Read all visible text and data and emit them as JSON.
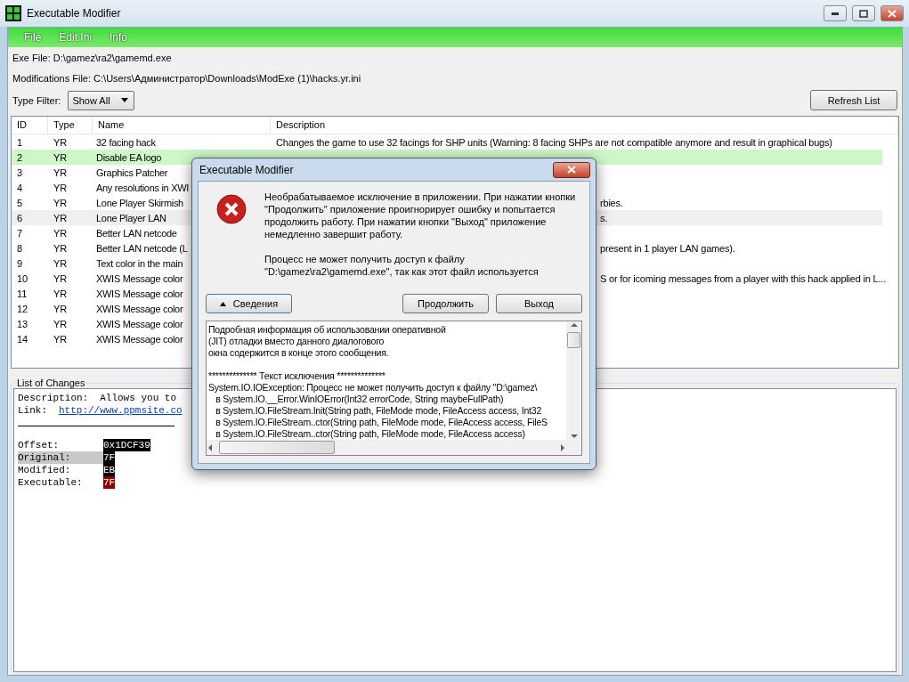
{
  "window": {
    "title": "Executable Modifier"
  },
  "menu": [
    "File",
    "Edit Ini",
    "Info"
  ],
  "exe_file": "Exe File: D:\\gamez\\ra2\\gamemd.exe",
  "modifications_file": "Modifications File: C:\\Users\\Администратор\\Downloads\\ModExe (1)\\hacks.yr.ini",
  "type_filter": {
    "label": "Type Filter:",
    "value": "Show All"
  },
  "refresh_button": "Refresh List",
  "table": {
    "columns": [
      "ID",
      "Type",
      "Name",
      "Description"
    ],
    "rows": [
      {
        "id": "1",
        "type": "YR",
        "name": "32 facing hack",
        "description": "Changes the game to use 32 facings for SHP units (Warning: 8 facing SHPs are not compatible anymore and result in graphical bugs)",
        "selected": false,
        "hovered": false,
        "cut": false
      },
      {
        "id": "2",
        "type": "YR",
        "name": "Disable EA logo",
        "selected": true,
        "hovered": false
      },
      {
        "id": "3",
        "type": "YR",
        "name": "Graphics Patcher",
        "selected": false,
        "hovered": false
      },
      {
        "id": "4",
        "type": "YR",
        "name": "Any resolutions in XWI",
        "selected": false,
        "hovered": false
      },
      {
        "id": "5",
        "type": "YR",
        "name": "Lone Player Skirmish",
        "description": "rbies.",
        "selected": false,
        "hovered": false,
        "cut": true
      },
      {
        "id": "6",
        "type": "YR",
        "name": "Lone Player LAN",
        "description": "s.",
        "selected": false,
        "hovered": true,
        "cut": true
      },
      {
        "id": "7",
        "type": "YR",
        "name": "Better LAN netcode",
        "selected": false,
        "hovered": false
      },
      {
        "id": "8",
        "type": "YR",
        "name": "Better LAN netcode (L",
        "description": "present in 1 player LAN games).",
        "selected": false,
        "hovered": false,
        "cut": true
      },
      {
        "id": "9",
        "type": "YR",
        "name": "Text color in the main",
        "selected": false,
        "hovered": false
      },
      {
        "id": "10",
        "type": "YR",
        "name": "XWIS Message color",
        "description": "S or for icoming messages from a player with this hack applied in L...",
        "selected": false,
        "hovered": false,
        "cut": true
      },
      {
        "id": "11",
        "type": "YR",
        "name": "XWIS Message color",
        "selected": false,
        "hovered": false
      },
      {
        "id": "12",
        "type": "YR",
        "name": "XWIS Message color",
        "selected": false,
        "hovered": false
      },
      {
        "id": "13",
        "type": "YR",
        "name": "XWIS Message color",
        "selected": false,
        "hovered": false
      },
      {
        "id": "14",
        "type": "YR",
        "name": "XWIS Message color",
        "selected": false,
        "hovered": false
      }
    ]
  },
  "changes": {
    "title": "List of Changes",
    "description_label": "Description:",
    "description": "Allows you to",
    "link_label": "Link:",
    "link": "http://www.ppmsite.co",
    "fields": [
      {
        "label": "Offset:",
        "value": "0x1DCF39",
        "color": "#000000",
        "label_highlighted": false
      },
      {
        "label": "Original:",
        "value": "7F",
        "color": "#000000",
        "label_highlighted": true
      },
      {
        "label": "Modified:",
        "value": "EB",
        "color": "#000000",
        "label_highlighted": false
      },
      {
        "label": "Executable:",
        "value": "7F",
        "color": "#8b0000",
        "label_highlighted": false
      }
    ]
  },
  "dialog": {
    "title": "Executable Modifier",
    "message": [
      "Необрабатываемое исключение в приложении. При нажатии кнопки \"Продолжить\" приложение проигнорирует ошибку и попытается продолжить работу. При нажатии кнопки \"Выход\" приложение немедленно завершит работу.",
      "Процесс не может получить доступ к файлу \"D:\\gamez\\ra2\\gamemd.exe\", так как этот файл используется"
    ],
    "details_button": "Сведения",
    "continue_button": "Продолжить",
    "exit_button": "Выход",
    "details_intro": [
      "Подробная информация об использовании оперативной",
      "(JIT) отладки вместо данного диалогового",
      "окна содержится в конце этого сообщения."
    ],
    "details_trace": [
      "************** Текст исключения **************",
      "System.IO.IOException: Процесс не может получить доступ к файлу \"D:\\gamez\\",
      "   в System.IO.__Error.WinIOError(Int32 errorCode, String maybeFullPath)",
      "   в System.IO.FileStream.Init(String path, FileMode mode, FileAccess access, Int32",
      "   в System.IO.FileStream..ctor(String path, FileMode mode, FileAccess access, FileS",
      "   в System.IO.FileStream..ctor(String path, FileMode mode, FileAccess access)"
    ]
  }
}
